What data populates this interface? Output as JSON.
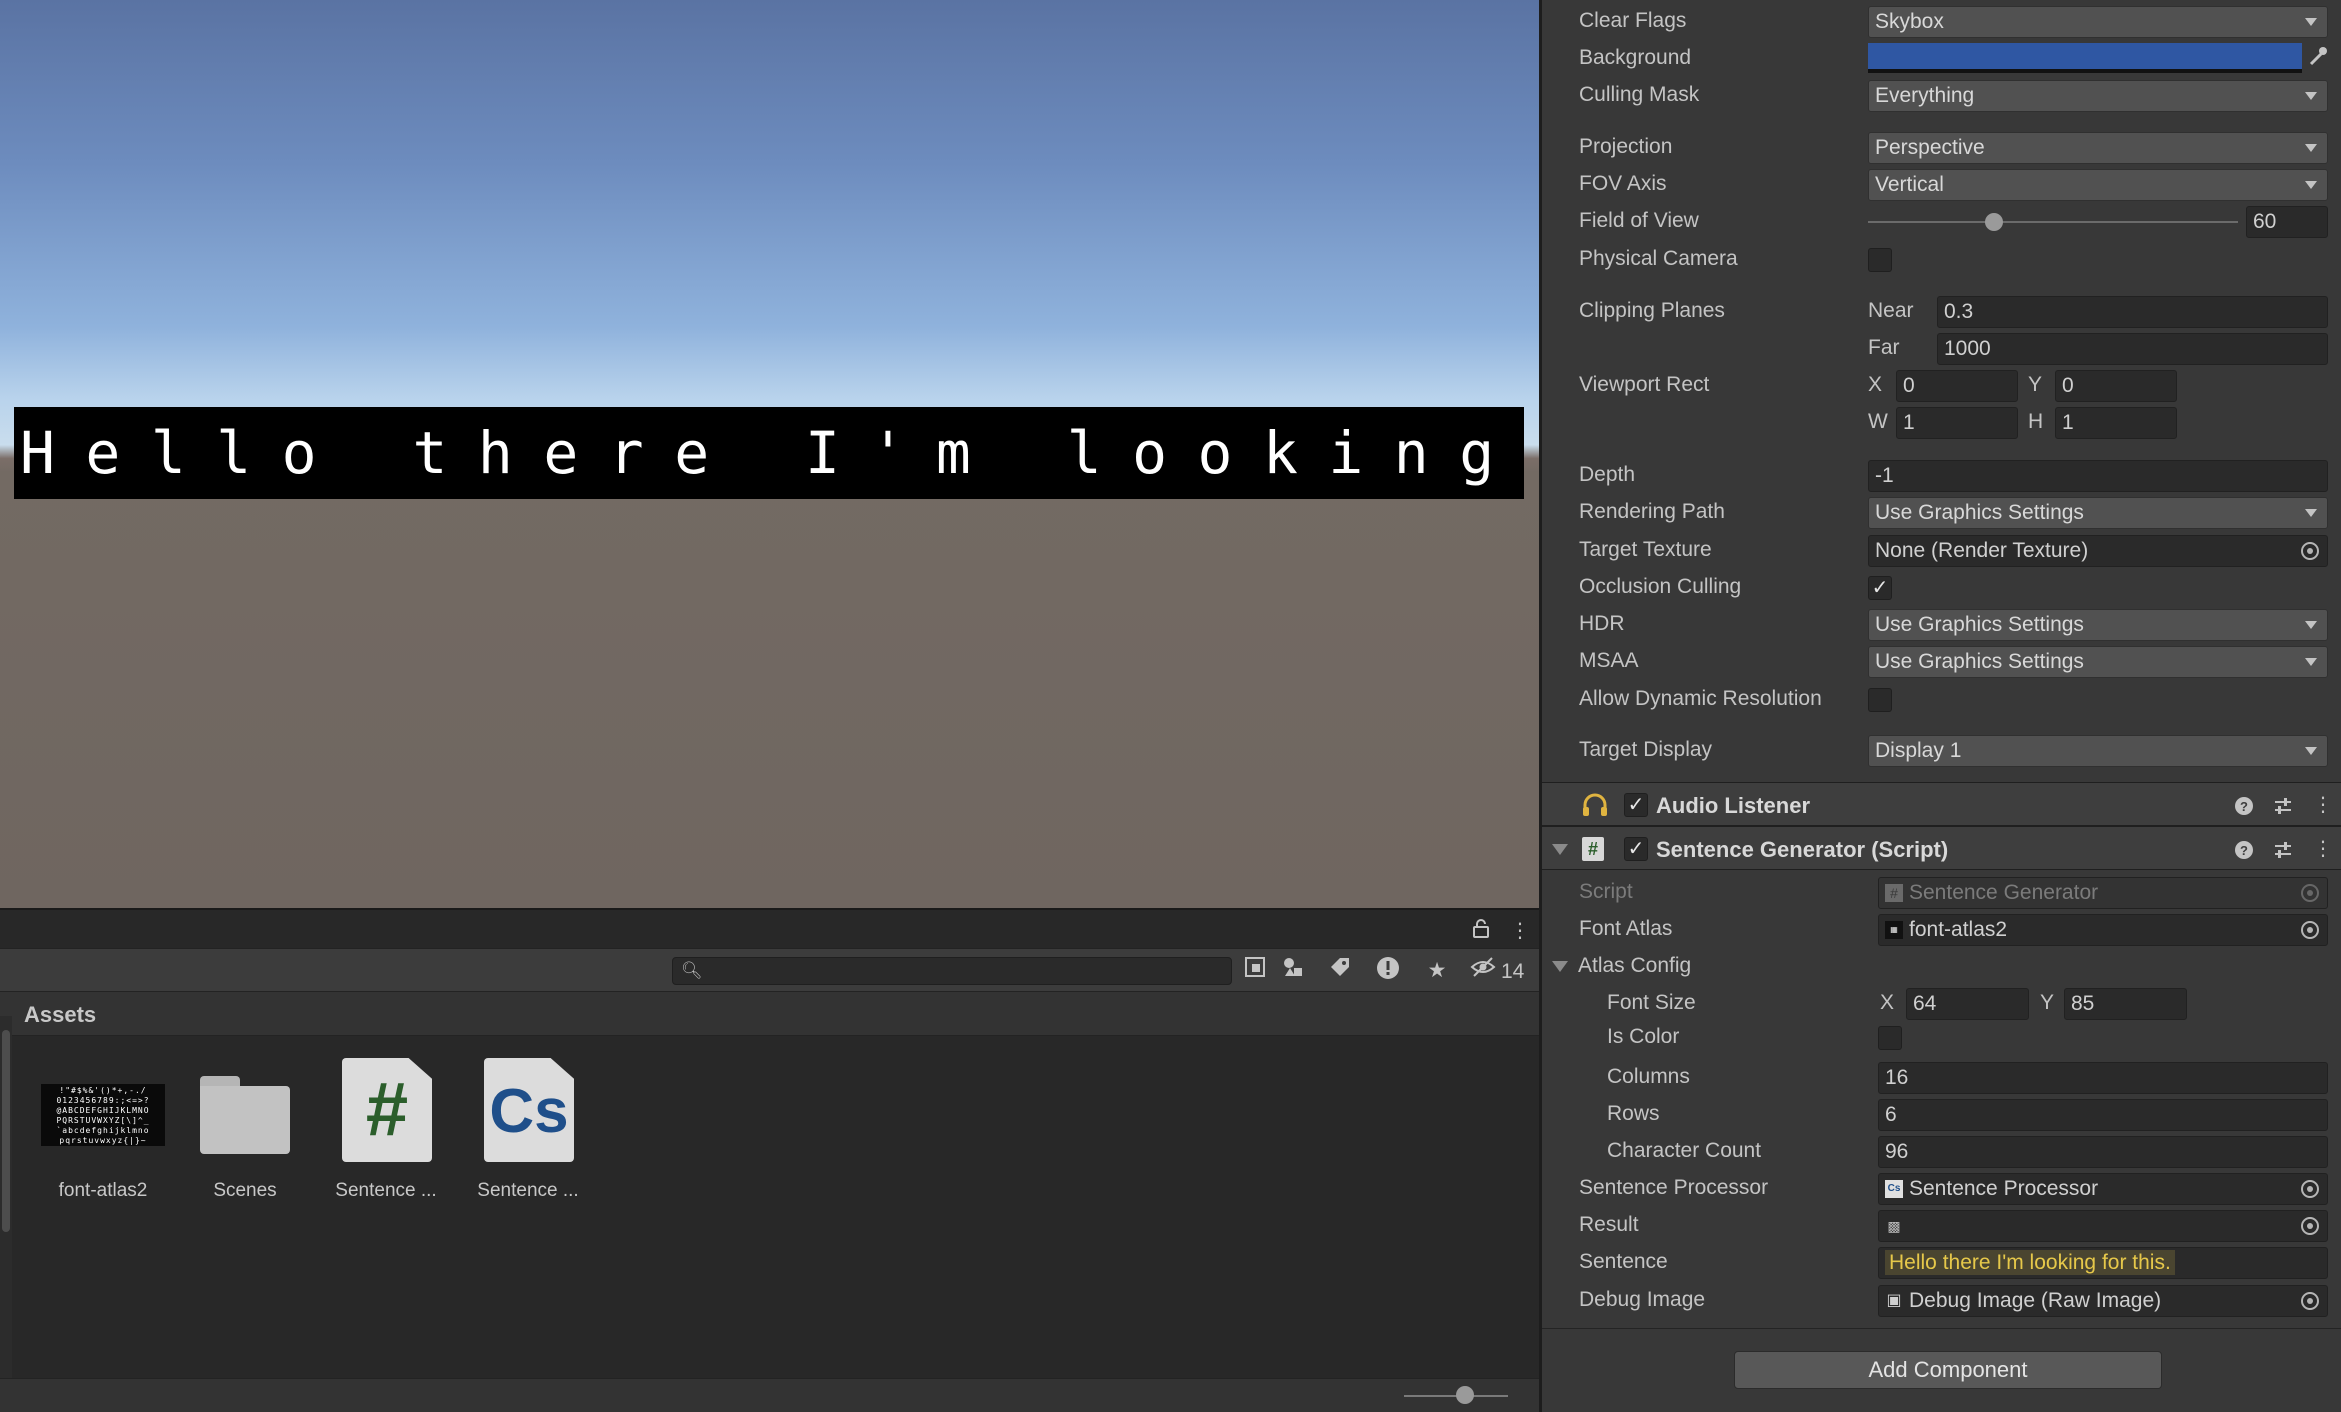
{
  "game_view": {
    "banner_text": "Hello there I'm looking for this."
  },
  "project": {
    "hidden_count": "14",
    "breadcrumb": "Assets",
    "font_thumb_text": "!\"#$%&'()*+,-./\n0123456789:;<=>?\n@ABCDEFGHIJKLMNO\nPQRSTUVWXYZ[\\]^_\n`abcdefghijklmno\npqrstuvwxyz{|}~",
    "assets": [
      {
        "name": "font-atlas2",
        "kind": "texture"
      },
      {
        "name": "Scenes",
        "kind": "folder"
      },
      {
        "name": "Sentence ...",
        "kind": "script",
        "glyph": "#",
        "glyph_color": "#2b5e2b"
      },
      {
        "name": "Sentence ...",
        "kind": "script",
        "glyph": "Cs",
        "glyph_color": "#1f4f8a"
      }
    ]
  },
  "inspector": {
    "clear_flags": {
      "label": "Clear Flags",
      "value": "Skybox"
    },
    "background": {
      "label": "Background",
      "color": "#2f57a3"
    },
    "culling_mask": {
      "label": "Culling Mask",
      "value": "Everything"
    },
    "projection": {
      "label": "Projection",
      "value": "Perspective"
    },
    "fov_axis": {
      "label": "FOV Axis",
      "value": "Vertical"
    },
    "field_of_view": {
      "label": "Field of View",
      "value": "60",
      "slider_fraction": 0.34
    },
    "physical_camera": {
      "label": "Physical Camera",
      "checked": false
    },
    "clipping_planes": {
      "label": "Clipping Planes",
      "near_label": "Near",
      "near": "0.3",
      "far_label": "Far",
      "far": "1000"
    },
    "viewport_rect": {
      "label": "Viewport Rect",
      "x_label": "X",
      "x": "0",
      "y_label": "Y",
      "y": "0",
      "w_label": "W",
      "w": "1",
      "h_label": "H",
      "h": "1"
    },
    "depth": {
      "label": "Depth",
      "value": "-1"
    },
    "rendering_path": {
      "label": "Rendering Path",
      "value": "Use Graphics Settings"
    },
    "target_texture": {
      "label": "Target Texture",
      "value": "None (Render Texture)"
    },
    "occlusion_culling": {
      "label": "Occlusion Culling",
      "checked": true,
      "check": "✓"
    },
    "hdr": {
      "label": "HDR",
      "value": "Use Graphics Settings"
    },
    "msaa": {
      "label": "MSAA",
      "value": "Use Graphics Settings"
    },
    "allow_dynamic_resolution": {
      "label": "Allow Dynamic Resolution",
      "checked": false
    },
    "target_display": {
      "label": "Target Display",
      "value": "Display 1"
    },
    "audio_listener": {
      "title": "Audio Listener",
      "check": "✓"
    },
    "sentence_generator": {
      "title": "Sentence Generator (Script)",
      "check": "✓",
      "script": {
        "label": "Script",
        "value": "Sentence Generator"
      },
      "font_atlas": {
        "label": "Font Atlas",
        "value": "font-atlas2"
      },
      "atlas_config": {
        "label": "Atlas Config",
        "font_size": {
          "label": "Font Size",
          "x_label": "X",
          "x": "64",
          "y_label": "Y",
          "y": "85"
        },
        "is_color": {
          "label": "Is Color",
          "checked": false
        },
        "columns": {
          "label": "Columns",
          "value": "16"
        },
        "rows": {
          "label": "Rows",
          "value": "6"
        },
        "character_count": {
          "label": "Character Count",
          "value": "96"
        }
      },
      "sentence_processor": {
        "label": "Sentence Processor",
        "value": "Sentence Processor"
      },
      "result": {
        "label": "Result",
        "value": ""
      },
      "sentence": {
        "label": "Sentence",
        "value": "Hello there I'm looking for this."
      },
      "debug_image": {
        "label": "Debug Image",
        "value": "Debug Image (Raw Image)"
      }
    },
    "add_component": "Add Component"
  }
}
